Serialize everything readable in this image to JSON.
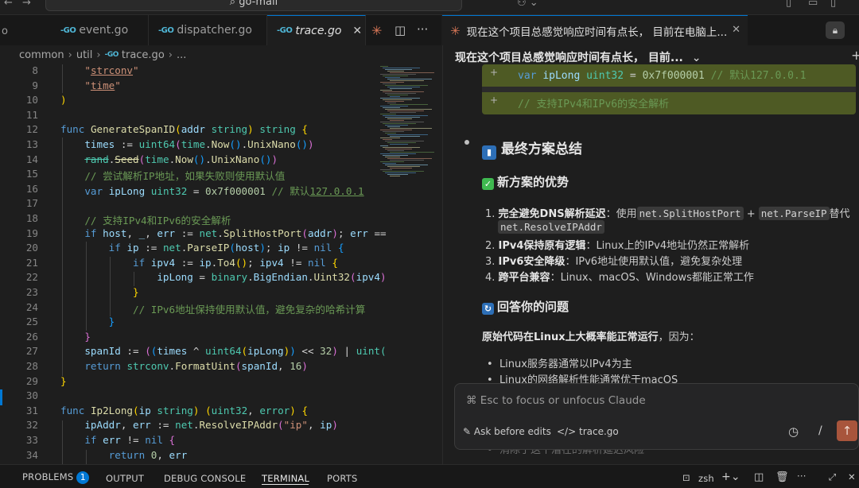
{
  "titlebar": {
    "search_text": "go-mail"
  },
  "editor_tabs": [
    {
      "label": "event.go",
      "icon": "go"
    },
    {
      "label": "dispatcher.go",
      "icon": "go"
    },
    {
      "label": "trace.go",
      "icon": "go",
      "active": true
    }
  ],
  "breadcrumb": [
    "common",
    "util",
    "trace.go",
    "..."
  ],
  "chat": {
    "tab_title": "现在这个项目总感觉响应时间有点长， 目前在电脑上...",
    "header_title": "现在这个项目总感觉响应时间有点长， 目前...",
    "diff_line": "var ipLong uint32 = 0x7f000001 // 默认127.0.0.1",
    "diff_line_2": "// 支持IPv4和IPv6的安全解析",
    "summary_heading": "最终方案总结",
    "advantages_heading": "新方案的优势",
    "adv1_bold": "完全避免DNS解析延迟",
    "adv1_text_a": "：使用",
    "adv1_code_1": "net.SplitHostPort",
    "adv1_plus": "+",
    "adv1_code_2": "net.ParseIP",
    "adv1_text_b": "替代",
    "adv1_code_3": "net.ResolveIPAddr",
    "adv2_bold": "IPv4保持原有逻辑",
    "adv2_text": "：Linux上的IPv4地址仍然正常解析",
    "adv3_bold": "IPv6安全降级",
    "adv3_text": "：IPv6地址使用默认值，避免复杂处理",
    "adv4_bold": "跨平台兼容",
    "adv4_text": "：Linux、macOS、Windows都能正常工作",
    "answer_heading": "回答你的问题",
    "answer_intro": "原始代码在Linux上大概率能正常运行",
    "answer_intro_tail": "，因为：",
    "bullet1": "Linux服务器通常以IPv4为主",
    "bullet2": "Linux的网络解析性能通常优于macOS",
    "bullet3": "消除了这个潜在的解析延迟风险",
    "prompt_placeholder": "⌘ Esc to focus or unfocus Claude",
    "ask_label": "Ask before edits",
    "file_ref": "trace.go",
    "slash": "/"
  },
  "statusbar": {
    "problems": "PROBLEMS",
    "problems_count": "1",
    "output": "OUTPUT",
    "debug": "DEBUG CONSOLE",
    "terminal": "TERMINAL",
    "ports": "PORTS",
    "shell": "zsh"
  },
  "colors": {
    "accent": "#0078d4",
    "claude": "#d97757"
  }
}
